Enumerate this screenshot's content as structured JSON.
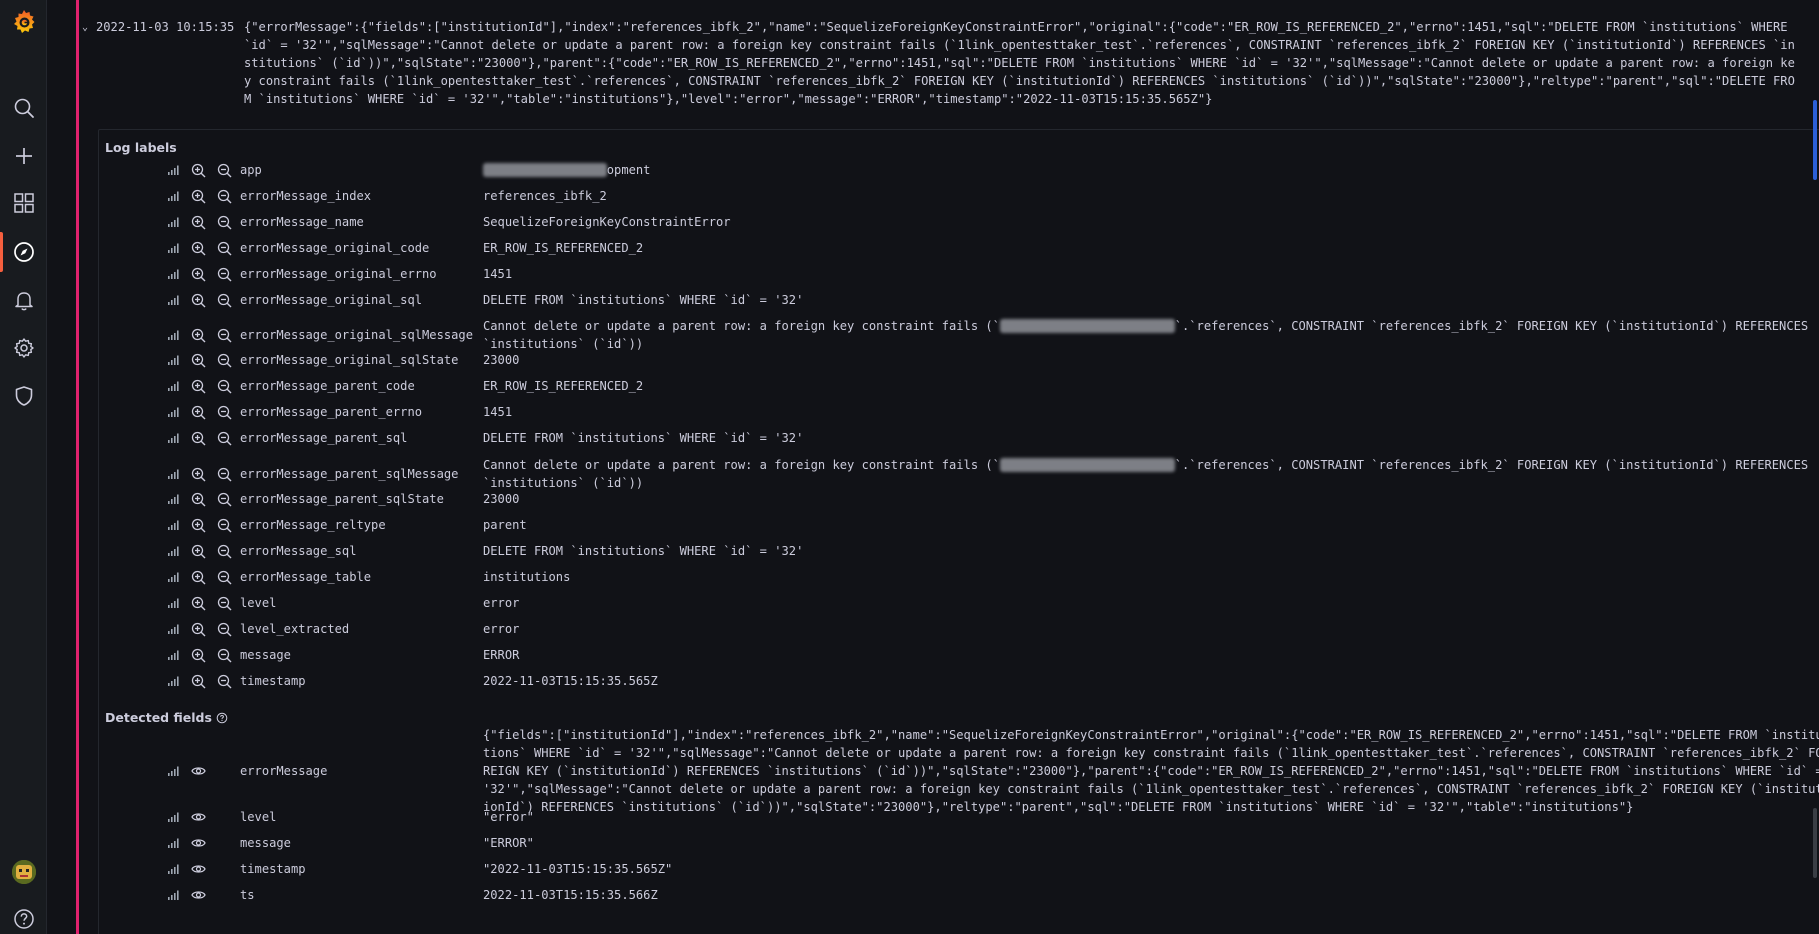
{
  "entry": {
    "timestamp": "2022-11-03 10:15:35",
    "message": "{\"errorMessage\":{\"fields\":[\"institutionId\"],\"index\":\"references_ibfk_2\",\"name\":\"SequelizeForeignKeyConstraintError\",\"original\":{\"code\":\"ER_ROW_IS_REFERENCED_2\",\"errno\":1451,\"sql\":\"DELETE FROM `institutions` WHERE `id` = '32'\",\"sqlMessage\":\"Cannot delete or update a parent row: a foreign key constraint fails (`1link_opentesttaker_test`.`references`, CONSTRAINT `references_ibfk_2` FOREIGN KEY (`institutionId`) REFERENCES `institutions` (`id`))\",\"sqlState\":\"23000\"},\"parent\":{\"code\":\"ER_ROW_IS_REFERENCED_2\",\"errno\":1451,\"sql\":\"DELETE FROM `institutions` WHERE `id` = '32'\",\"sqlMessage\":\"Cannot delete or update a parent row: a foreign key constraint fails (`1link_opentesttaker_test`.`references`, CONSTRAINT `references_ibfk_2` FOREIGN KEY (`institutionId`) REFERENCES `institutions` (`id`))\",\"sqlState\":\"23000\"},\"reltype\":\"parent\",\"sql\":\"DELETE FROM `institutions` WHERE `id` = '32'\",\"table\":\"institutions\"},\"level\":\"error\",\"message\":\"ERROR\",\"timestamp\":\"2022-11-03T15:15:35.565Z\"}"
  },
  "log_labels": {
    "title": "Log labels",
    "rows": [
      {
        "key": "app",
        "value_redacted": "xxxxxxxxxxxxxxxxx",
        "value": "opment"
      },
      {
        "key": "errorMessage_index",
        "value": "references_ibfk_2"
      },
      {
        "key": "errorMessage_name",
        "value": "SequelizeForeignKeyConstraintError"
      },
      {
        "key": "errorMessage_original_code",
        "value": "ER_ROW_IS_REFERENCED_2"
      },
      {
        "key": "errorMessage_original_errno",
        "value": "1451"
      },
      {
        "key": "errorMessage_original_sql",
        "value": "DELETE FROM `institutions` WHERE `id` = '32'"
      },
      {
        "key": "errorMessage_original_sqlMessage",
        "value_a": "Cannot delete or update a parent row: a foreign key constraint fails (`",
        "value_redacted": "1link_opentesttaker_test",
        "value_b": "`.`references`, CONSTRAINT `references_ibfk_2` FOREIGN KEY (`institutionId`) REFERENCES `institutions` (`id`))"
      },
      {
        "key": "errorMessage_original_sqlState",
        "value": "23000"
      },
      {
        "key": "errorMessage_parent_code",
        "value": "ER_ROW_IS_REFERENCED_2"
      },
      {
        "key": "errorMessage_parent_errno",
        "value": "1451"
      },
      {
        "key": "errorMessage_parent_sql",
        "value": "DELETE FROM `institutions` WHERE `id` = '32'"
      },
      {
        "key": "errorMessage_parent_sqlMessage",
        "value_a": "Cannot delete or update a parent row: a foreign key constraint fails (`",
        "value_redacted": "1link_opentesttaker_test",
        "value_b": "`.`references`, CONSTRAINT `references_ibfk_2` FOREIGN KEY (`institutionId`) REFERENCES `institutions` (`id`))"
      },
      {
        "key": "errorMessage_parent_sqlState",
        "value": "23000"
      },
      {
        "key": "errorMessage_reltype",
        "value": "parent"
      },
      {
        "key": "errorMessage_sql",
        "value": "DELETE FROM `institutions` WHERE `id` = '32'"
      },
      {
        "key": "errorMessage_table",
        "value": "institutions"
      },
      {
        "key": "level",
        "value": "error"
      },
      {
        "key": "level_extracted",
        "value": "error"
      },
      {
        "key": "message",
        "value": "ERROR"
      },
      {
        "key": "timestamp",
        "value": "2022-11-03T15:15:35.565Z"
      }
    ]
  },
  "detected_fields": {
    "title": "Detected fields",
    "rows": [
      {
        "key": "errorMessage",
        "value": "{\"fields\":[\"institutionId\"],\"index\":\"references_ibfk_2\",\"name\":\"SequelizeForeignKeyConstraintError\",\"original\":{\"code\":\"ER_ROW_IS_REFERENCED_2\",\"errno\":1451,\"sql\":\"DELETE FROM `institutions` WHERE `id` = '32'\",\"sqlMessage\":\"Cannot delete or update a parent row: a foreign key constraint fails (`1link_opentesttaker_test`.`references`, CONSTRAINT `references_ibfk_2` FOREIGN KEY (`institutionId`) REFERENCES `institutions` (`id`))\",\"sqlState\":\"23000\"},\"parent\":{\"code\":\"ER_ROW_IS_REFERENCED_2\",\"errno\":1451,\"sql\":\"DELETE FROM `institutions` WHERE `id` = '32'\",\"sqlMessage\":\"Cannot delete or update a parent row: a foreign key constraint fails (`1link_opentesttaker_test`.`references`, CONSTRAINT `references_ibfk_2` FOREIGN KEY (`institutionId`) REFERENCES `institutions` (`id`))\",\"sqlState\":\"23000\"},\"reltype\":\"parent\",\"sql\":\"DELETE FROM `institutions` WHERE `id` = '32'\",\"table\":\"institutions\"}"
      },
      {
        "key": "level",
        "value": "\"error\""
      },
      {
        "key": "message",
        "value": "\"ERROR\""
      },
      {
        "key": "timestamp",
        "value": "\"2022-11-03T15:15:35.565Z\""
      },
      {
        "key": "ts",
        "value": "2022-11-03T15:15:35.566Z"
      }
    ]
  },
  "colors": {
    "accent": "#f55f3e",
    "error_bar": "#e0226e",
    "scroll_thumb": "#2c5fd8"
  },
  "icons": {
    "sidebar": [
      "grafana-logo-icon",
      "search-icon",
      "plus-icon",
      "dashboards-icon",
      "explore-compass-icon",
      "alert-bell-icon",
      "gear-icon",
      "shield-icon",
      "help-icon"
    ],
    "row": [
      "stats-bars-icon",
      "zoom-in-icon",
      "zoom-out-icon",
      "eye-icon",
      "info-circle-icon"
    ]
  }
}
